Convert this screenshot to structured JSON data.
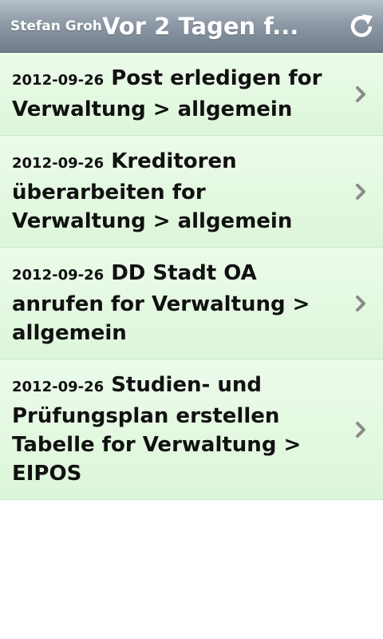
{
  "header": {
    "user": "Stefan Groh",
    "title": "Vor 2 Tagen f...",
    "refresh_icon": "refresh-icon"
  },
  "tasks": [
    {
      "date": "2012-09-26",
      "text": "Post erledigen for Verwaltung > allgemein"
    },
    {
      "date": "2012-09-26",
      "text": "Kreditoren überarbeiten for Verwaltung > allgemein"
    },
    {
      "date": "2012-09-26",
      "text": "DD Stadt OA anrufen for Verwaltung > allgemein"
    },
    {
      "date": "2012-09-26",
      "text": "Studien- und Prüfungsplan erstellen Tabelle for Verwaltung > EIPOS"
    }
  ],
  "colors": {
    "header": "#8d99a6",
    "row_background": "#dcf6d9",
    "chevron": "#8a8a8a"
  }
}
